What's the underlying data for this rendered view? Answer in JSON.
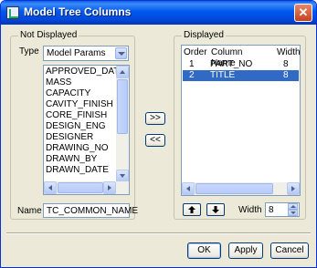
{
  "window": {
    "title": "Model Tree Columns"
  },
  "not_displayed": {
    "group_label": "Not Displayed",
    "type_label": "Type",
    "type_value": "Model Params",
    "items": [
      "APPROVED_DATE",
      "MASS",
      "CAPACITY",
      "CAVITY_FINISH",
      "CORE_FINISH",
      "DESIGN_ENG",
      "DESIGNER",
      "DRAWING_NO",
      "DRAWN_BY",
      "DRAWN_DATE"
    ],
    "name_label": "Name",
    "name_value": "TC_COMMON_NAME"
  },
  "transfer": {
    "add_label": ">>",
    "remove_label": "<<"
  },
  "displayed": {
    "group_label": "Displayed",
    "columns": [
      "Order",
      "Column Name",
      "Width"
    ],
    "rows": [
      {
        "order": "1",
        "name": "PART_NO",
        "width": "8",
        "selected": false
      },
      {
        "order": "2",
        "name": "TITLE",
        "width": "8",
        "selected": true
      }
    ],
    "width_label": "Width",
    "width_value": "8"
  },
  "footer": {
    "ok_label": "OK",
    "apply_label": "Apply",
    "cancel_label": "Cancel"
  },
  "colors": {
    "selection": "#316ac5",
    "titlebar": "#0058ee",
    "dialog_bg": "#ece9d8"
  }
}
